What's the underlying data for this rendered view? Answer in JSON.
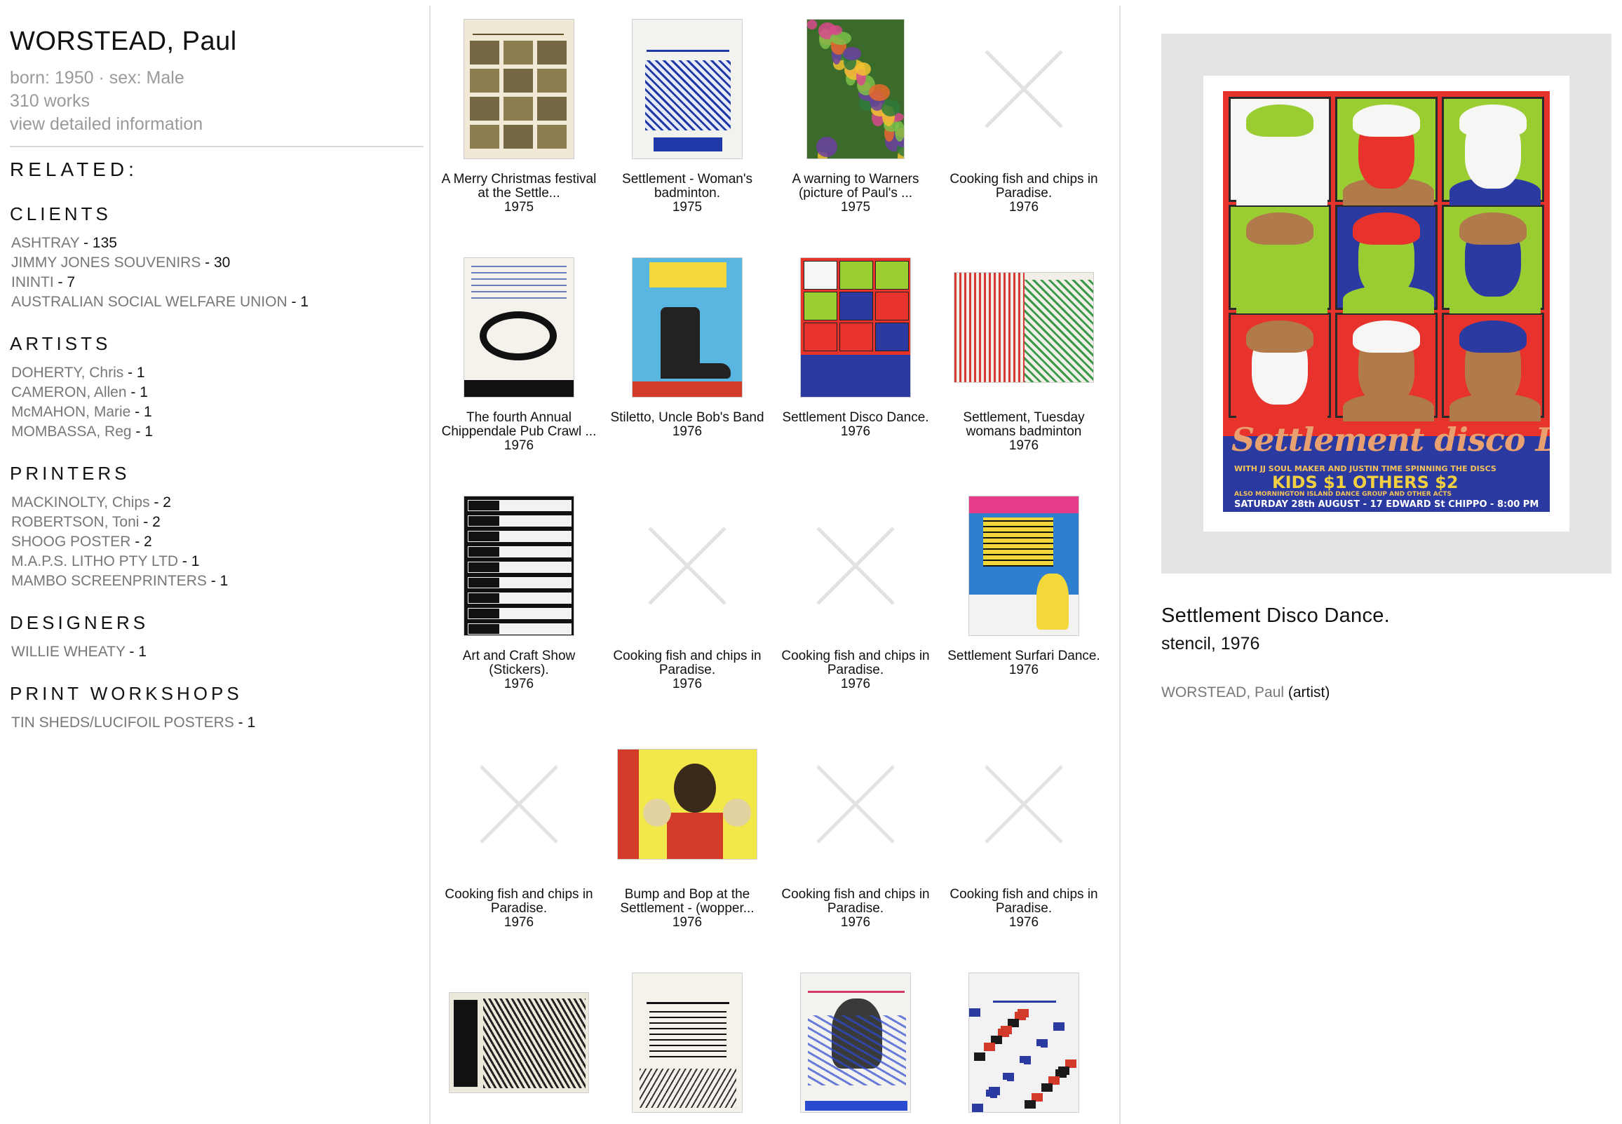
{
  "artist": {
    "name": "WORSTEAD, Paul",
    "born_sex": "born: 1950 · sex: Male",
    "works_count": "310 works",
    "detail_link": "view detailed information"
  },
  "related": {
    "title": "RELATED:",
    "groups": [
      {
        "title": "CLIENTS",
        "items": [
          {
            "name": "ASHTRAY",
            "count": " - 135"
          },
          {
            "name": "JIMMY JONES SOUVENIRS",
            "count": " - 30"
          },
          {
            "name": "ININTI",
            "count": " - 7"
          },
          {
            "name": "AUSTRALIAN SOCIAL WELFARE UNION",
            "count": " - 1"
          }
        ]
      },
      {
        "title": "ARTISTS",
        "items": [
          {
            "name": "DOHERTY, Chris",
            "count": " - 1"
          },
          {
            "name": "CAMERON, Allen",
            "count": " - 1"
          },
          {
            "name": "McMAHON, Marie",
            "count": " - 1"
          },
          {
            "name": "MOMBASSA, Reg",
            "count": " - 1"
          }
        ]
      },
      {
        "title": "PRINTERS",
        "items": [
          {
            "name": "MACKINOLTY, Chips",
            "count": " - 2"
          },
          {
            "name": "ROBERTSON, Toni",
            "count": " - 2"
          },
          {
            "name": "SHOOG POSTER",
            "count": " - 2"
          },
          {
            "name": "M.A.P.S. LITHO PTY LTD",
            "count": " - 1"
          },
          {
            "name": "MAMBO SCREENPRINTERS",
            "count": " - 1"
          }
        ]
      },
      {
        "title": "DESIGNERS",
        "items": [
          {
            "name": "WILLIE WHEATY",
            "count": " - 1"
          }
        ]
      },
      {
        "title": "PRINT WORKSHOPS",
        "items": [
          {
            "name": "TIN SHEDS/LUCIFOIL POSTERS",
            "count": " - 1"
          }
        ]
      }
    ]
  },
  "works": [
    {
      "title": "A Merry Christmas festival at the Settle...",
      "year": "1975",
      "thumb": "sepia-collage"
    },
    {
      "title": "Settlement - Woman's badminton.",
      "year": "1975",
      "thumb": "blue-badminton"
    },
    {
      "title": "A warning to Warners (picture of Paul's ...",
      "year": "1975",
      "thumb": "jungle"
    },
    {
      "title": "Cooking fish and chips in Paradise.",
      "year": "1976",
      "thumb": "missing"
    },
    {
      "title": "The fourth Annual Chippendale Pub Crawl ...",
      "year": "1976",
      "thumb": "pub-crawl"
    },
    {
      "title": "Stiletto, Uncle Bob's Band",
      "year": "1976",
      "thumb": "stiletto-boot"
    },
    {
      "title": "Settlement Disco Dance.",
      "year": "1976",
      "thumb": "disco-faces"
    },
    {
      "title": "Settlement, Tuesday womans badminton",
      "year": "1976",
      "thumb": "red-green-landscape"
    },
    {
      "title": "Art and Craft Show (Stickers).",
      "year": "1976",
      "thumb": "stickers"
    },
    {
      "title": "Cooking fish and chips in Paradise.",
      "year": "1976",
      "thumb": "missing"
    },
    {
      "title": "Cooking fish and chips in Paradise.",
      "year": "1976",
      "thumb": "missing"
    },
    {
      "title": "Settlement Surfari Dance.",
      "year": "1976",
      "thumb": "surfari-color"
    },
    {
      "title": "Cooking fish and chips in Paradise.",
      "year": "1976",
      "thumb": "missing"
    },
    {
      "title": "Bump and Bop at the Settlement - (wopper...",
      "year": "1976",
      "thumb": "bump-bop"
    },
    {
      "title": "Cooking fish and chips in Paradise.",
      "year": "1976",
      "thumb": "missing"
    },
    {
      "title": "Cooking fish and chips in Paradise.",
      "year": "1976",
      "thumb": "missing"
    },
    {
      "title": "",
      "year": "",
      "thumb": "dance-bw"
    },
    {
      "title": "",
      "year": "",
      "thumb": "surfari-bw"
    },
    {
      "title": "",
      "year": "",
      "thumb": "young-peoples-dance"
    },
    {
      "title": "",
      "year": "",
      "thumb": "tolstoy-read"
    }
  ],
  "selected": {
    "title": "Settlement Disco Dance.",
    "medium_year": "stencil, 1976",
    "credit_name": "WORSTEAD, Paul",
    "credit_role": " (artist)",
    "poster": {
      "script": "Settlement disco DANCE",
      "line1": "WITH JJ SOUL MAKER AND JUSTIN TIME  SPINNING THE DISCS",
      "line2": "KIDS $1  OTHERS $2",
      "line3": "ALSO MORNINGTON ISLAND DANCE GROUP AND OTHER ACTS",
      "line4": "SATURDAY 28th AUGUST - 17 EDWARD St CHIPPO - 8:00 PM"
    }
  },
  "colors": {
    "link_gray": "#777777",
    "meta_gray": "#9a9a9a",
    "divider": "#e3e3e3",
    "preview_bg": "#e4e4e4",
    "poster_red": "#e8322c",
    "poster_green": "#9acd32",
    "poster_blue": "#2b3aa0"
  }
}
